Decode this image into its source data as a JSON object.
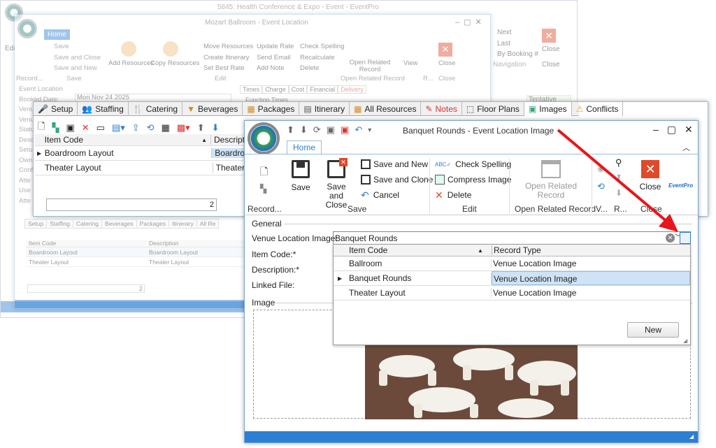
{
  "bg_window": {
    "title": "5845: Health Conference & Expo - Event - EventPro",
    "nav_items": [
      "Next",
      "Last",
      "By Booking #"
    ],
    "nav_label": "Navigation",
    "close_label": "Close",
    "edit_label": "Edi",
    "status_label": "Tentative"
  },
  "mid_window": {
    "title": "Mozart Ballroom - Event Location",
    "tab": "Home",
    "save_items": [
      "Save",
      "Save and Close",
      "Save and New"
    ],
    "save_group": "Save",
    "add_resources": "Add Resources",
    "copy_resources": "Copy Resources",
    "edit_col1": [
      "Move Resources",
      "Create Itinerary",
      "Set Best Rate"
    ],
    "edit_col2": [
      "Update Rate",
      "Send Email",
      "Add Note"
    ],
    "edit_col3": [
      "Check Spelling",
      "Recalculate",
      "Delete"
    ],
    "edit_group": "Edit",
    "open_related": "Open Related Record",
    "open_related_group": "Open Related Record",
    "view_label": "View",
    "close_label": "Close",
    "record_label": "Record...",
    "r_label": "R...",
    "side_labels": [
      "Event Location",
      "Booked Date:",
      "Venu",
      "Venu",
      "Statu",
      "Desc",
      "Setu",
      "Own",
      "Conf",
      "Atte",
      "Use",
      "Atte"
    ],
    "booked_date": "Mon Nov 24 2025",
    "right_tabs": [
      "Times",
      "Charge",
      "Cost",
      "Financial",
      "Delivery"
    ],
    "function_times": "Function Times",
    "small_tabs": [
      "Setup",
      "Staffing",
      "Catering",
      "Beverages",
      "Packages",
      "Itinerary",
      "All Re"
    ],
    "grid_headers": [
      "Item Code",
      "Description"
    ],
    "rows": [
      [
        "Boardroom Layout",
        "Boardroom Layout"
      ],
      [
        "Theater Layout",
        "Theater Layout"
      ]
    ],
    "count": "2"
  },
  "tabs_panel": {
    "tabs": [
      "Setup",
      "Staffing",
      "Catering",
      "Beverages",
      "Packages",
      "Itinerary",
      "All Resources",
      "Notes",
      "Floor Plans",
      "Images",
      "Conflicts"
    ],
    "grid_headers": [
      "Item Code",
      "Descript"
    ],
    "rows": [
      [
        "Boardroom Layout",
        "Boardro"
      ],
      [
        "Theater Layout",
        "Theater"
      ]
    ],
    "count": "2"
  },
  "dialog": {
    "title": "Banquet Rounds - Event Location Image",
    "tab": "Home",
    "record_label": "Record...",
    "save": "Save",
    "save_close": "Save and Close",
    "save_new": "Save and New",
    "save_clone": "Save and Clone",
    "cancel": "Cancel",
    "save_group": "Save",
    "check_spelling": "Check Spelling",
    "compress_image": "Compress Image",
    "delete": "Delete",
    "edit_group": "Edit",
    "open_related": "Open Related Record",
    "open_related_group": "Open Related Record",
    "v_label": "V...",
    "r_label": "R...",
    "close": "Close",
    "close_group": "Close",
    "logo": "EventPro",
    "general": "General",
    "venue_location_label": "Venue Location Image:",
    "venue_location_value": "Banquet Rounds",
    "item_code_label": "Item Code:*",
    "description_label": "Description:*",
    "linked_file_label": "Linked File:",
    "image_label": "Image",
    "dropdown": {
      "headers": [
        "Item Code",
        "Record Type"
      ],
      "rows": [
        [
          "Ballroom",
          "Venue Location Image"
        ],
        [
          "Banquet Rounds",
          "Venue Location Image"
        ],
        [
          "Theater Layout",
          "Venue Location Image"
        ]
      ],
      "selected_index": 1,
      "new_button": "New"
    }
  },
  "colors": {
    "accent": "#2c7fd3",
    "close_red": "#e04a2a",
    "arrow": "#e8151b",
    "selected_row": "#cfe3f7"
  }
}
